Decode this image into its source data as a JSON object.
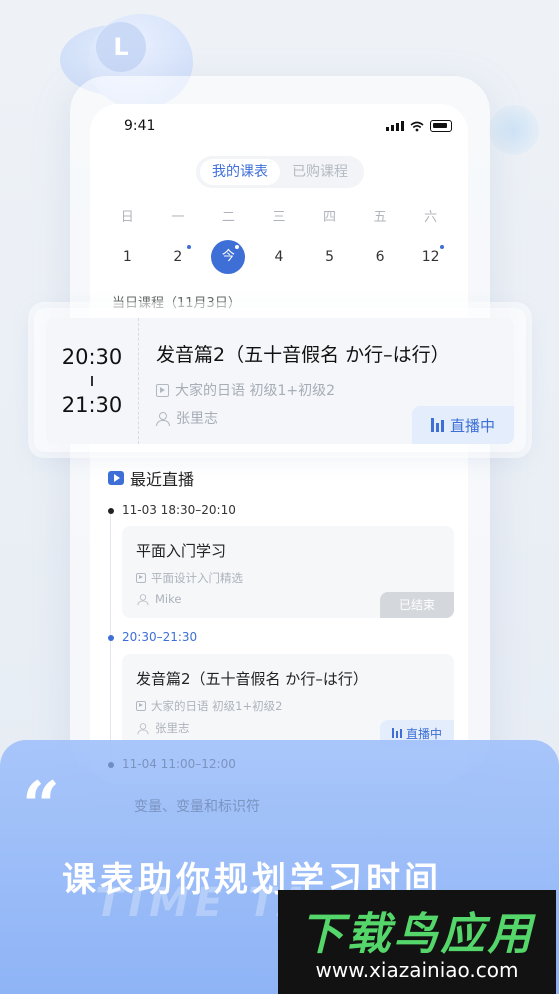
{
  "status": {
    "time": "9:41"
  },
  "tabs": {
    "my_schedule": "我的课表",
    "purchased": "已购课程"
  },
  "week": {
    "days": [
      "日",
      "一",
      "二",
      "三",
      "四",
      "五",
      "六"
    ],
    "dates": [
      "1",
      "2",
      "今",
      "4",
      "5",
      "6",
      "12"
    ]
  },
  "day_label": "当日课程（11月3日）",
  "featured": {
    "start": "20:30",
    "end": "21:30",
    "title": "发音篇2（五十音假名 か行–は行）",
    "series": "大家的日语 初级1+初级2",
    "teacher": "张里志",
    "status": "直播中"
  },
  "recent": {
    "heading": "最近直播",
    "items": [
      {
        "time": "11-03 18:30–20:10",
        "title": "平面入门学习",
        "series": "平面设计入门精选",
        "teacher": "Mike",
        "status": "已结束"
      },
      {
        "time": "20:30–21:30",
        "title": "发音篇2（五十音假名 か行–は行）",
        "series": "大家的日语 初级1+初级2",
        "teacher": "张里志",
        "status": "直播中"
      },
      {
        "time": "11-04 11:00–12:00",
        "title": "变量、变量和标识符"
      }
    ]
  },
  "banner": {
    "quote": "“",
    "slogan": "课表助你规划学习时间",
    "ghost": "TIME TA"
  },
  "watermark": {
    "title": "下载鸟应用",
    "url": "www.xiazainiao.com"
  },
  "colors": {
    "accent": "#3d6fd6",
    "banner": "#9bbcf8"
  }
}
